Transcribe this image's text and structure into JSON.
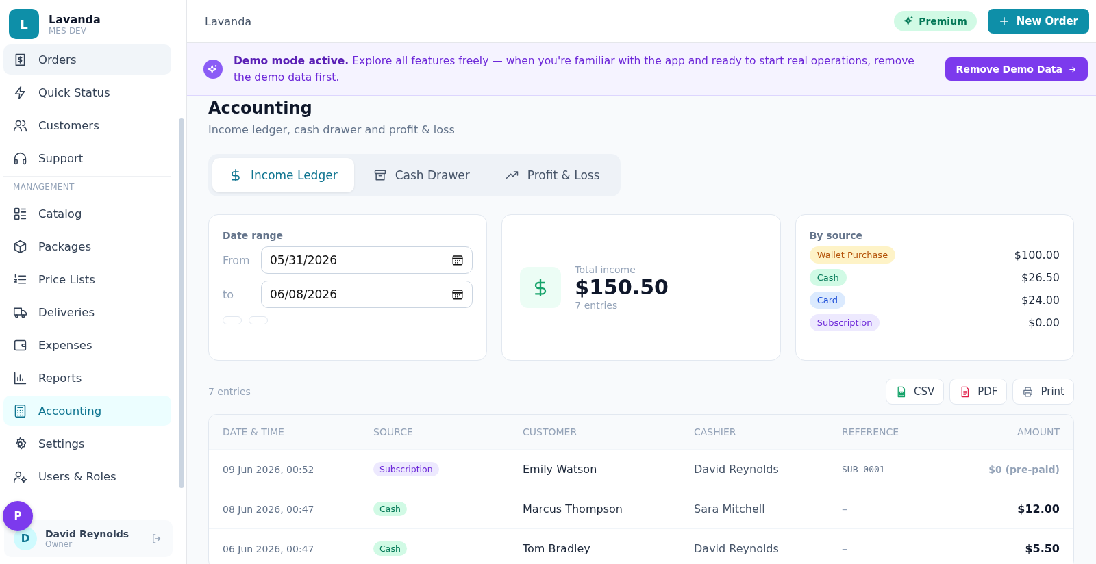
{
  "brand": {
    "letter": "L",
    "name": "Lavanda",
    "org": "MES-DEV"
  },
  "nav_top": [
    {
      "label": "Orders",
      "selected": false,
      "hovered": true
    },
    {
      "label": "Quick Status",
      "selected": false,
      "hovered": false
    },
    {
      "label": "Customers",
      "selected": false,
      "hovered": false
    },
    {
      "label": "Support",
      "selected": false,
      "hovered": false
    }
  ],
  "nav_section": "MANAGEMENT",
  "nav_management": [
    {
      "label": "Catalog",
      "selected": false,
      "hovered": false
    },
    {
      "label": "Packages",
      "selected": false,
      "hovered": false
    },
    {
      "label": "Price Lists",
      "selected": false,
      "hovered": false
    },
    {
      "label": "Deliveries",
      "selected": false,
      "hovered": false
    },
    {
      "label": "Expenses",
      "selected": false,
      "hovered": false
    },
    {
      "label": "Reports",
      "selected": false,
      "hovered": false
    },
    {
      "label": "Accounting",
      "selected": true,
      "hovered": false
    },
    {
      "label": "Settings",
      "selected": false,
      "hovered": false
    },
    {
      "label": "Users & Roles",
      "selected": false,
      "hovered": false
    }
  ],
  "user": {
    "initial": "D",
    "name": "David Reynolds",
    "role": "Owner"
  },
  "floating_avatar": {
    "letter": "P"
  },
  "header": {
    "title": "Lavanda",
    "premium": "Premium",
    "new_order": "New Order"
  },
  "banner": {
    "text": "**Demo mode active.** Explore all features freely — when you're familiar with the app and ready to start real operations, remove the demo data first.",
    "button": "Remove Demo Data"
  },
  "page": {
    "title": "Accounting",
    "subtitle": "Income ledger, cash drawer and profit & loss"
  },
  "tabs": [
    {
      "label": "Income Ledger",
      "selected": true
    },
    {
      "label": "Cash Drawer",
      "selected": false
    },
    {
      "label": "Profit & Loss",
      "selected": false
    }
  ],
  "date_range": {
    "title": "Date range",
    "from_label": "From",
    "from": "05/31/2026",
    "to_label": "to",
    "to": "06/08/2026"
  },
  "total": {
    "label": "Total income",
    "amount": "$150.50",
    "entries": "7 entries"
  },
  "by_source": {
    "title": "By source",
    "items": [
      {
        "kind": "wallet",
        "label": "Wallet Purchase",
        "amount": "$100.00"
      },
      {
        "kind": "cash",
        "label": "Cash",
        "amount": "$26.50"
      },
      {
        "kind": "card",
        "label": "Card",
        "amount": "$24.00"
      },
      {
        "kind": "subscription",
        "label": "Subscription",
        "amount": "$0.00"
      }
    ]
  },
  "entries_count": "7 entries",
  "export_buttons": [
    {
      "kind": "csv",
      "label": "CSV"
    },
    {
      "kind": "pdf",
      "label": "PDF"
    },
    {
      "kind": "print",
      "label": "Print"
    }
  ],
  "table": {
    "columns": [
      "DATE & TIME",
      "SOURCE",
      "CUSTOMER",
      "CASHIER",
      "REFERENCE",
      "AMOUNT"
    ],
    "rows": [
      {
        "date": "09 Jun 2026, 00:52",
        "source": {
          "kind": "subscription",
          "label": "Subscription"
        },
        "customer": "Emily Watson",
        "cashier": "David Reynolds",
        "reference": "SUB-0001",
        "reference_muted": false,
        "amount": "$0 (pre-paid)",
        "amount_muted": true
      },
      {
        "date": "08 Jun 2026, 00:47",
        "source": {
          "kind": "cash",
          "label": "Cash"
        },
        "customer": "Marcus Thompson",
        "cashier": "Sara Mitchell",
        "reference": "–",
        "reference_muted": true,
        "amount": "$12.00",
        "amount_muted": false
      },
      {
        "date": "06 Jun 2026, 00:47",
        "source": {
          "kind": "cash",
          "label": "Cash"
        },
        "customer": "Tom Bradley",
        "cashier": "David Reynolds",
        "reference": "–",
        "reference_muted": true,
        "amount": "$5.50",
        "amount_muted": false
      }
    ]
  }
}
